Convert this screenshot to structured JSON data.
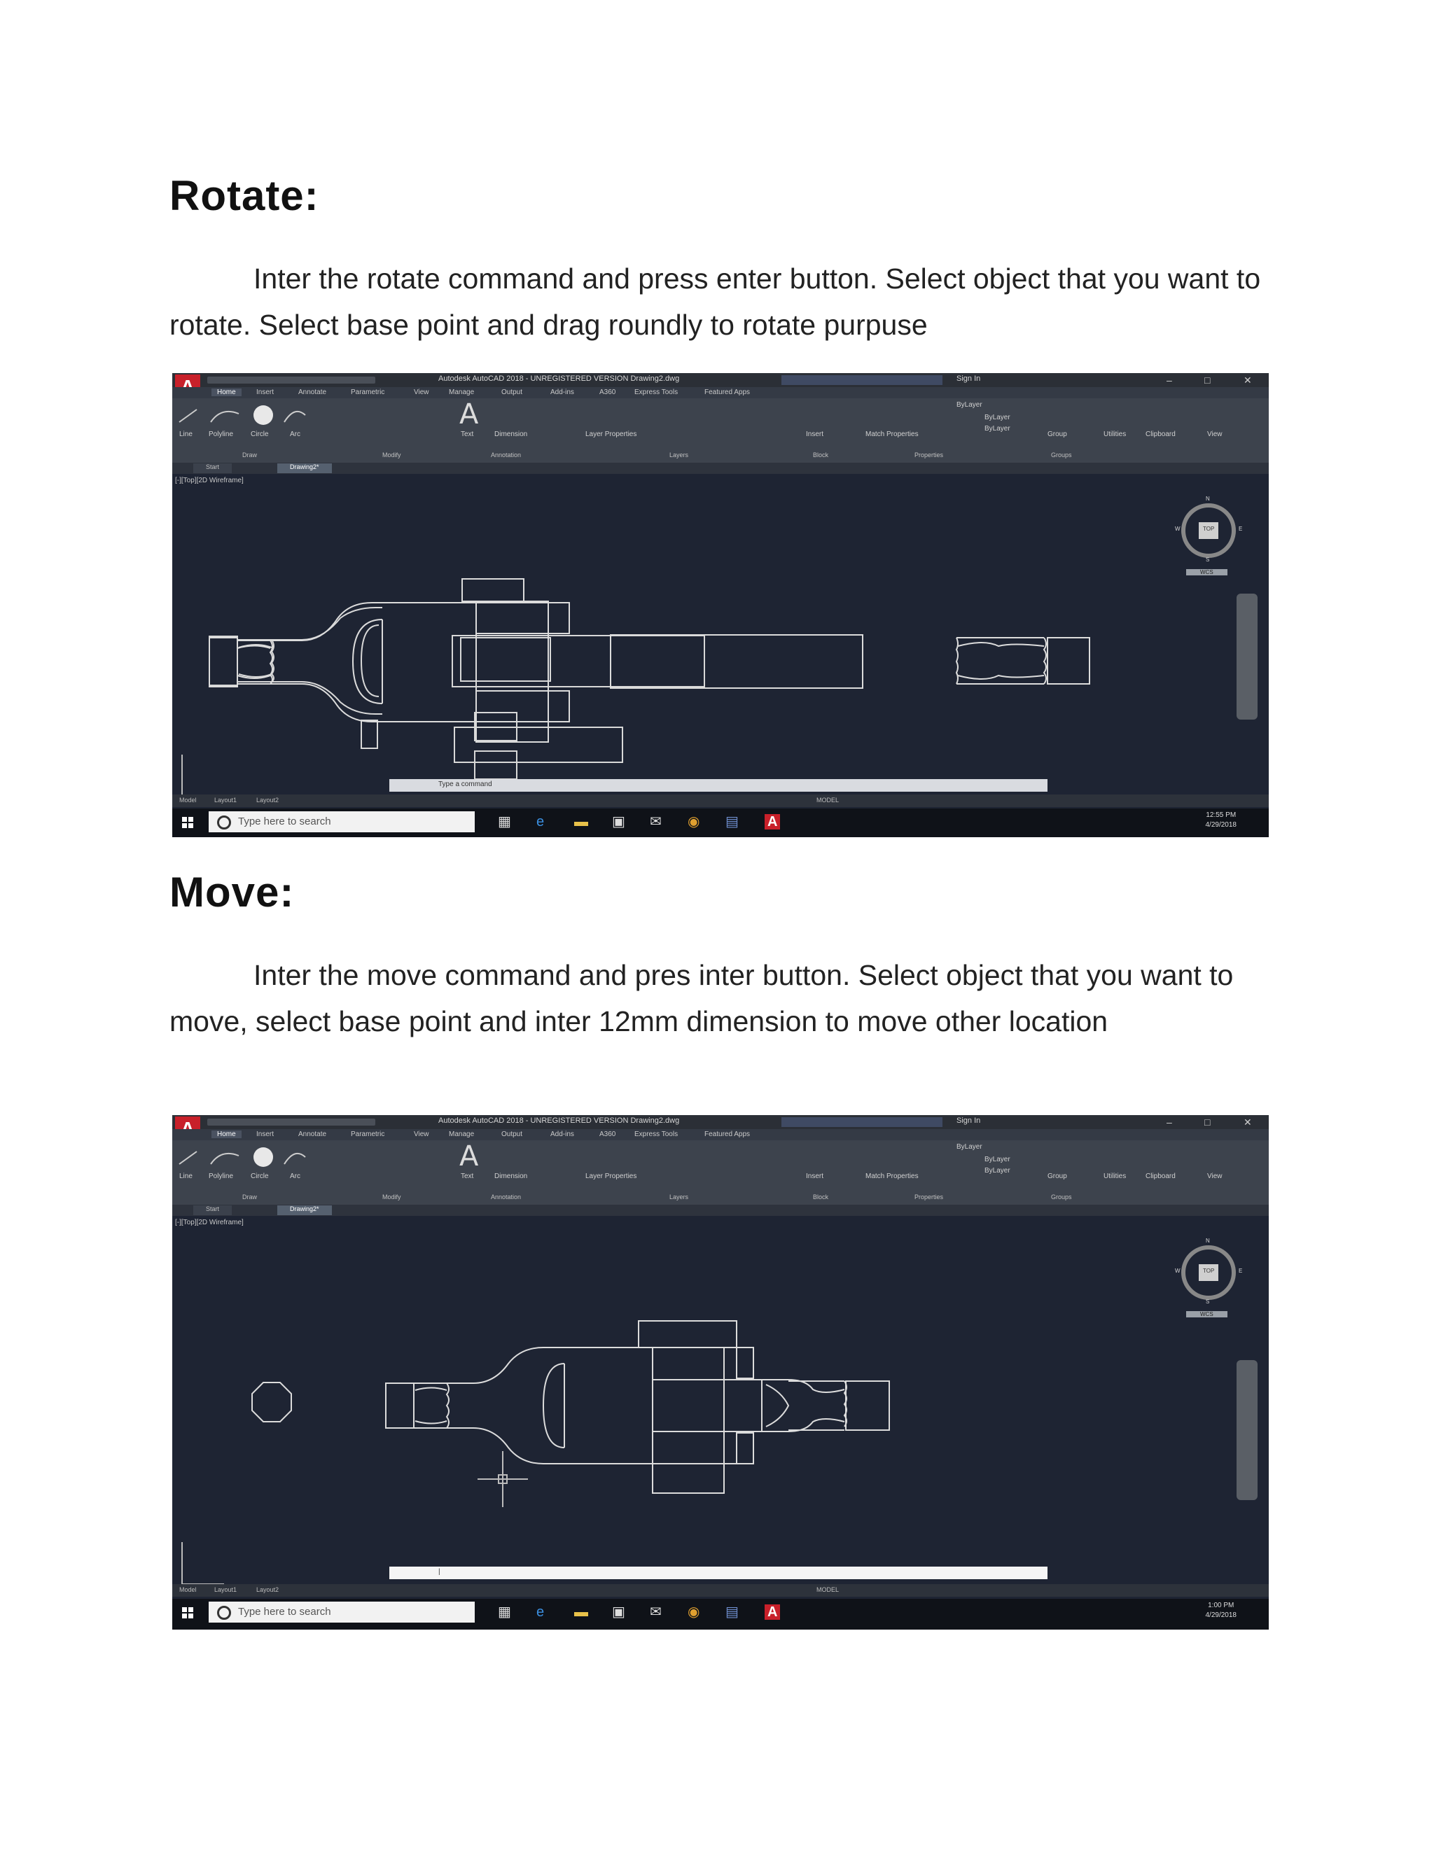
{
  "sections": [
    {
      "heading": "Rotate:",
      "paragraph": "Inter the rotate command and press enter button. Select object that you want to rotate. Select base point and drag roundly to rotate purpuse"
    },
    {
      "heading": "Move:",
      "paragraph": "Inter the move command and pres inter button. Select object that you want to move, select base point and inter 12mm dimension to move  other location"
    }
  ],
  "app": {
    "logo": "A",
    "title": "Autodesk AutoCAD 2018 - UNREGISTERED VERSION   Drawing2.dwg",
    "sign_in": "Sign In",
    "ribbon_tabs": [
      "Home",
      "Insert",
      "Annotate",
      "Parametric",
      "View",
      "Manage",
      "Output",
      "Add-ins",
      "A360",
      "Express Tools",
      "Featured Apps"
    ],
    "draw_tools": [
      "Line",
      "Polyline",
      "Circle",
      "Arc"
    ],
    "panels": [
      "Draw",
      "Modify",
      "Annotation",
      "Layers",
      "Block",
      "Properties",
      "Groups"
    ],
    "annotation_tools": [
      "Text",
      "Dimension"
    ],
    "layer_tool": "Layer Properties",
    "block_tool": "Insert",
    "match_tool": "Match Properties",
    "bylayer": "ByLayer",
    "group_tool": "Group",
    "utility_tools": [
      "Utilities",
      "Clipboard",
      "View"
    ],
    "doc_tabs": [
      "Start",
      "Drawing2*"
    ],
    "viewport_label": "[-][Top][2D Wireframe]",
    "navcube_label": "TOP",
    "compass": [
      "N",
      "W",
      "E",
      "S"
    ],
    "wcs": "WCS",
    "layout_tabs": [
      "Model",
      "Layout1",
      "Layout2"
    ],
    "model_label": "MODEL",
    "command_prompt_1": "Type a command",
    "command_prompt_2": "|",
    "taskbar_search": "Type here to search"
  },
  "screenshots": [
    {
      "time": "12:55 PM",
      "date": "4/29/2018"
    },
    {
      "time": "1:00 PM",
      "date": "4/29/2018"
    }
  ]
}
